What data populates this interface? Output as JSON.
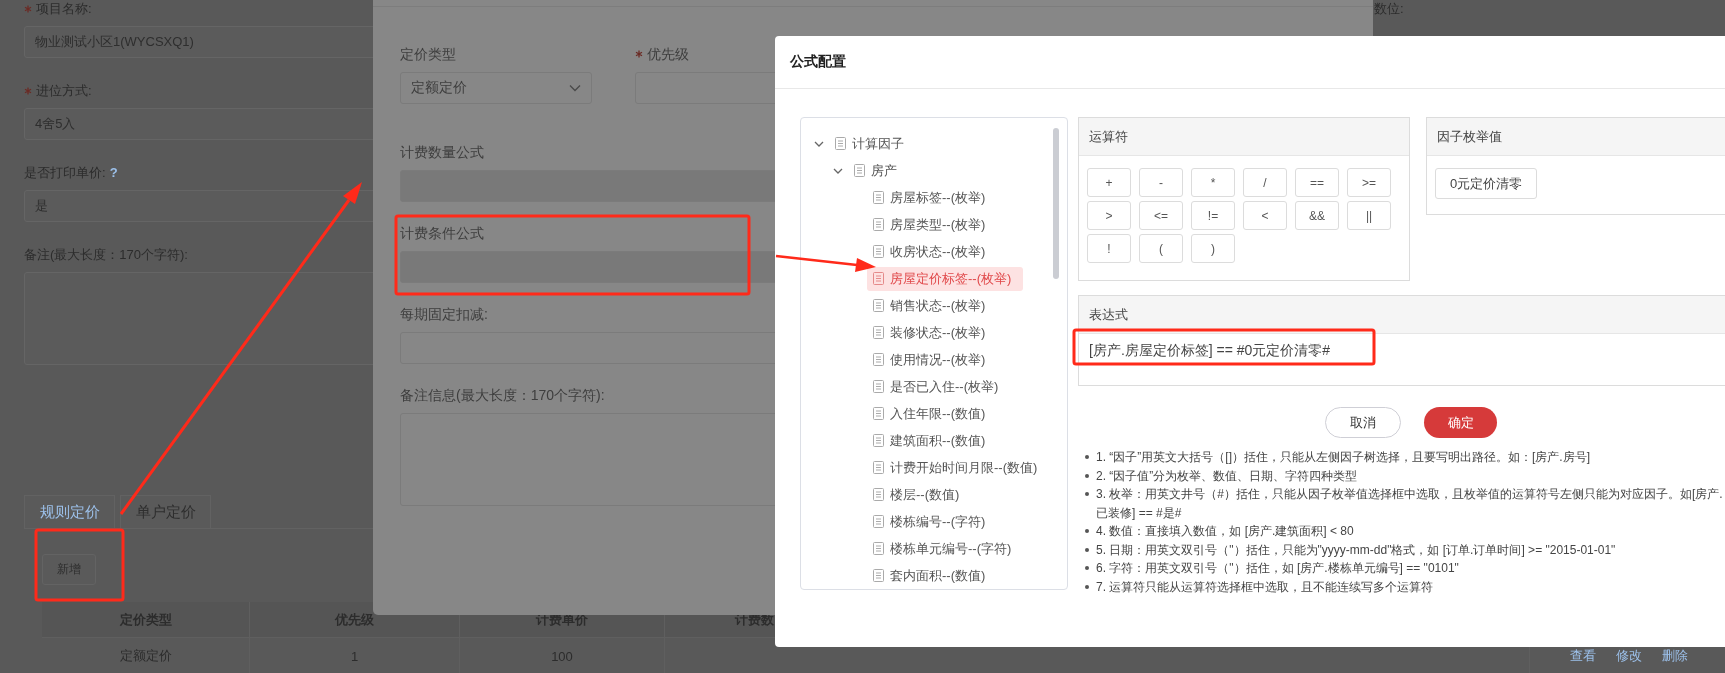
{
  "background_page": {
    "fields": [
      {
        "label": "项目名称:",
        "required": true,
        "kind": "input",
        "value": "物业测试小区1(WYCSXQ1)"
      },
      {
        "label": "进位方式:",
        "required": true,
        "kind": "input",
        "value": "4舍5入"
      },
      {
        "label": "是否打印单价:",
        "help": "?",
        "kind": "input",
        "value": "是"
      },
      {
        "label": "备注(最大长度：170个字符):",
        "kind": "textarea"
      }
    ],
    "right_label": "数位:",
    "tabs": [
      {
        "label": "规则定价",
        "selected": true
      },
      {
        "label": "单户定价",
        "selected": false
      }
    ],
    "add_button": "新增",
    "table": {
      "columns": [
        "定价类型",
        "优先级",
        "计费单价",
        "计费数"
      ],
      "rows": [
        {
          "cells": [
            "定额定价",
            "1",
            "100"
          ],
          "actions": [
            "查看",
            "修改",
            "删除"
          ]
        }
      ]
    }
  },
  "pricing_dialog": {
    "top_row": [
      {
        "label": "定价类型",
        "kind": "select",
        "value": "定额定价"
      },
      {
        "label": "优先级",
        "required": true,
        "kind": "input"
      }
    ],
    "fields": [
      {
        "label": "计费数量公式",
        "kind": "input",
        "disabled": true
      },
      {
        "label": "计费条件公式",
        "kind": "input",
        "disabled": true
      },
      {
        "label": "每期固定扣减:",
        "kind": "input",
        "disabled": false
      },
      {
        "label": "备注信息(最大长度：170个字符):",
        "kind": "textarea",
        "disabled": false
      }
    ]
  },
  "formula_dialog": {
    "title": "公式配置",
    "tree": {
      "label": "计算因子",
      "expanded": true,
      "selected": false,
      "children": [
        {
          "label": "房产",
          "expanded": true,
          "selected": false,
          "children": [
            {
              "label": "房屋标签--(枚举)",
              "selected": false
            },
            {
              "label": "房屋类型--(枚举)",
              "selected": false
            },
            {
              "label": "收房状态--(枚举)",
              "selected": false
            },
            {
              "label": "房屋定价标签--(枚举)",
              "selected": true
            },
            {
              "label": "销售状态--(枚举)",
              "selected": false
            },
            {
              "label": "装修状态--(枚举)",
              "selected": false
            },
            {
              "label": "使用情况--(枚举)",
              "selected": false
            },
            {
              "label": "是否已入住--(枚举)",
              "selected": false
            },
            {
              "label": "入住年限--(数值)",
              "selected": false
            },
            {
              "label": "建筑面积--(数值)",
              "selected": false
            },
            {
              "label": "计费开始时间月限--(数值)",
              "selected": false
            },
            {
              "label": "楼层--(数值)",
              "selected": false
            },
            {
              "label": "楼栋编号--(字符)",
              "selected": false
            },
            {
              "label": "楼栋单元编号--(字符)",
              "selected": false
            },
            {
              "label": "套内面积--(数值)",
              "selected": false
            }
          ]
        }
      ]
    },
    "operators_panel": {
      "title": "运算符",
      "operators": [
        "+",
        "-",
        "*",
        "/",
        "==",
        ">=",
        ">",
        "<=",
        "!=",
        "<",
        "&&",
        "||",
        "!",
        "(",
        ")"
      ]
    },
    "enum_panel": {
      "title": "因子枚举值",
      "values": [
        "0元定价清零"
      ]
    },
    "expression_panel": {
      "title": "表达式",
      "value": "[房产.房屋定价标签] == #0元定价清零#"
    },
    "buttons": [
      {
        "label": "取消",
        "kind": "secondary"
      },
      {
        "label": "确定",
        "kind": "primary"
      }
    ],
    "notes": [
      {
        "lines": [
          "1. “因子”用英文大括号（[]）括住，只能从左侧因子树选择，且要写明出路径。如：[房产.房号]"
        ]
      },
      {
        "lines": [
          "2. “因子值”分为枚举、数值、日期、字符四种类型"
        ]
      },
      {
        "lines": [
          "3. 枚举：用英文井号（#）括住，只能从因子枚举值选择框中选取，且枚举值的运算符号左侧只能为对应因子。如[房产.",
          "已装修] == #是#"
        ]
      },
      {
        "lines": [
          "4. 数值：直接填入数值，如 [房产.建筑面积] < 80"
        ]
      },
      {
        "lines": [
          "5. 日期：用英文双引号（\"）括住，只能为\"yyyy-mm-dd\"格式，如 [订单.订单时间] >= \"2015-01-01\""
        ]
      },
      {
        "lines": [
          "6. 字符：用英文双引号（\"）括住，如 [房产.楼栋单元编号] == \"0101\""
        ]
      },
      {
        "lines": [
          "7. 运算符只能从运算符选择框中选取，且不能连续写多个运算符"
        ]
      }
    ]
  }
}
